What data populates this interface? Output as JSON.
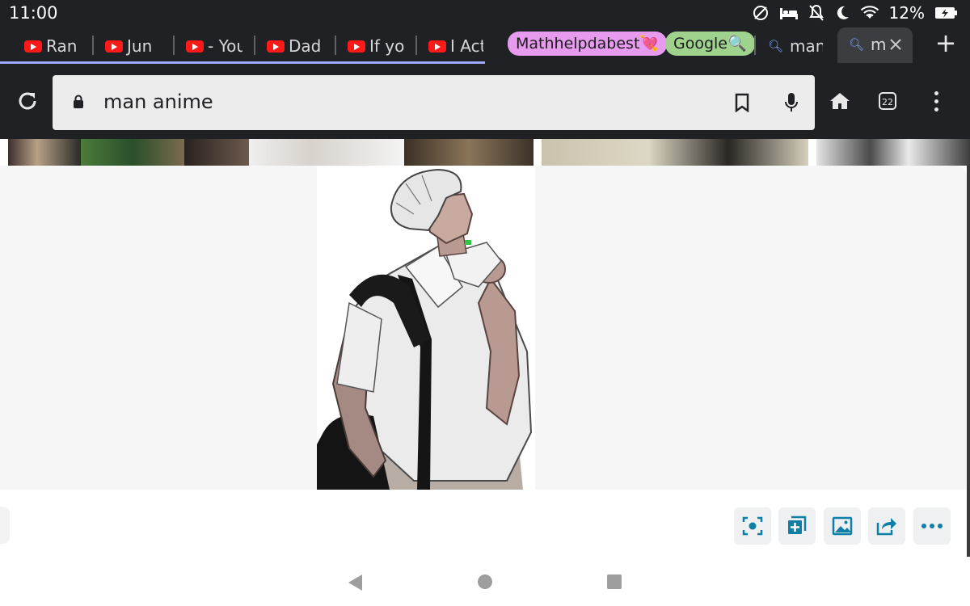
{
  "status_bar": {
    "time": "11:00",
    "battery_percent": "12%",
    "icons": [
      "no-sim-icon",
      "bed-icon",
      "notifications-off-icon",
      "moon-icon",
      "wifi-icon",
      "battery-charging-icon"
    ]
  },
  "tabs": {
    "youtube_tabs": [
      "Ran",
      "Jun",
      "- You",
      "Dad",
      "If yo",
      "I Act"
    ],
    "groups": [
      {
        "label": "Mathhelpdabest💘",
        "color": "#e79bee"
      },
      {
        "label": "Google🔍",
        "color": "#9fd38d"
      }
    ],
    "search_tab": "man",
    "active_tab": "m",
    "new_tab_label": "+"
  },
  "toolbar": {
    "url": "man anime",
    "tab_count": "22"
  },
  "colors": {
    "chrome_dark": "#202124",
    "omnibox": "#ececec",
    "action_icon": "#0f7fa6",
    "tab_underline": "#9fa8ff"
  },
  "viewer": {
    "image_subject": "anime-style drawing of a white-haired man in a white shirt with a black shoulder bag",
    "actions": [
      "lens-search-icon",
      "add-to-collection-icon",
      "image-icon",
      "share-icon",
      "more-icon"
    ]
  },
  "nav": [
    "back-icon",
    "home-icon",
    "recents-icon"
  ]
}
